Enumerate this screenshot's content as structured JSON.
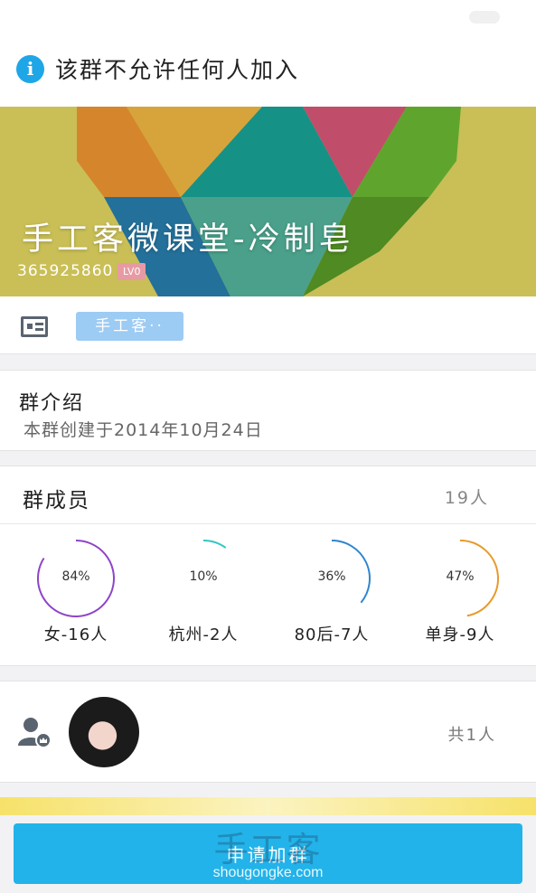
{
  "notice": {
    "icon": "info-icon",
    "text": "该群不允许任何人加入"
  },
  "banner": {
    "title": "手工客微课堂-冷制皂",
    "group_id": "365925860",
    "level": "LV0",
    "colors": {
      "background": "#c9bf56",
      "orange": "#d5862c",
      "gold": "#d6a43a",
      "teal": "#169186",
      "pink": "#c04e6a",
      "green": "#5fa52d",
      "blue": "#23709a",
      "mint": "#4aa08a"
    }
  },
  "category": {
    "icon": "id-card-icon",
    "tag": "手工客··"
  },
  "intro": {
    "heading": "群介绍",
    "text": "本群创建于2014年10月24日"
  },
  "members": {
    "title": "群成员",
    "count": "19人",
    "stats": [
      {
        "percent": 84,
        "percent_label": "84%",
        "label": "女-16人",
        "color": "#8e44c9"
      },
      {
        "percent": 10,
        "percent_label": "10%",
        "label": "杭州-2人",
        "color": "#35c6c6"
      },
      {
        "percent": 36,
        "percent_label": "36%",
        "label": "80后-7人",
        "color": "#2f86d0"
      },
      {
        "percent": 47,
        "percent_label": "47%",
        "label": "单身-9人",
        "color": "#e89a2a"
      }
    ]
  },
  "admins": {
    "icon": "admin-user-icon",
    "count": "共1人"
  },
  "join_button": {
    "label": "申请加群",
    "color": "#22b3ea"
  },
  "watermark": {
    "text": "手工客",
    "url": "shougongke.com"
  }
}
